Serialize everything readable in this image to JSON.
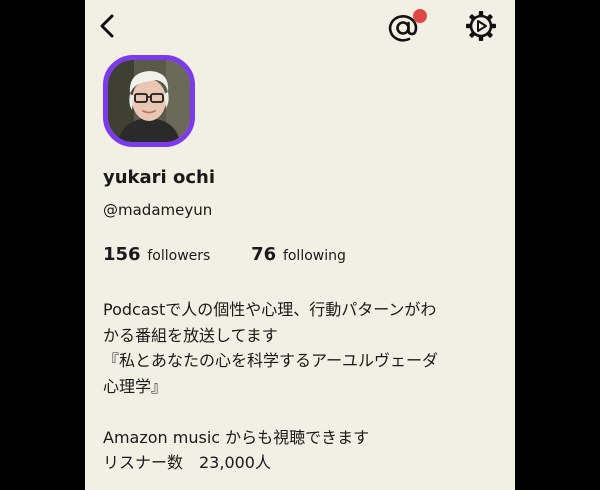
{
  "colors": {
    "background": "#f2efe4",
    "outer": "#000000",
    "avatar_ring": "#7c3aed",
    "notification_dot": "#e04848",
    "text": "#1a1a1a"
  },
  "header": {
    "back_icon": "chevron-left-icon",
    "mention_icon": "at-sign-icon",
    "settings_icon": "gear-icon"
  },
  "profile": {
    "name": "yukari ochi",
    "handle": "@madameyun",
    "followers_count": "156",
    "followers_label": "followers",
    "following_count": "76",
    "following_label": "following"
  },
  "bio": {
    "lines": [
      "Podcastで人の個性や心理、行動パターンがわ",
      "かる番組を放送してます",
      "『私とあなたの心を科学するアーユルヴェーダ",
      "心理学』",
      "",
      "Amazon music からも視聴できます",
      "リスナー数　23,000人"
    ]
  }
}
